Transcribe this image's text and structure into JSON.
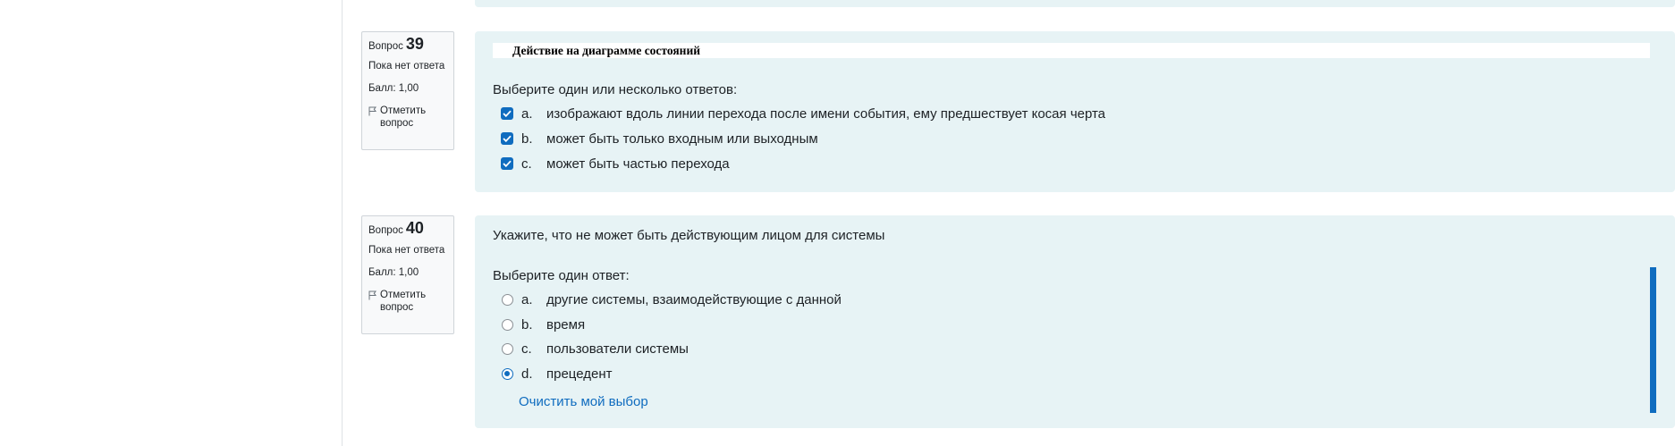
{
  "questions": [
    {
      "label": "Вопрос",
      "number": "39",
      "status": "Пока нет ответа",
      "grade": "Балл: 1,00",
      "flag_label": "Отметить вопрос",
      "text": "Действие на диаграмме состояний",
      "prompt": "Выберите один или несколько ответов:",
      "type": "checkbox",
      "options": [
        {
          "letter": "a.",
          "text": "изображают вдоль линии перехода после имени события, ему предшествует косая черта",
          "checked": true
        },
        {
          "letter": "b.",
          "text": "может быть только входным или выходным",
          "checked": true
        },
        {
          "letter": "c.",
          "text": "может быть частью перехода",
          "checked": true
        }
      ]
    },
    {
      "label": "Вопрос",
      "number": "40",
      "status": "Пока нет ответа",
      "grade": "Балл: 1,00",
      "flag_label": "Отметить вопрос",
      "text": "Укажите, что не может быть действующим лицом для системы",
      "prompt": "Выберите один ответ:",
      "type": "radio",
      "options": [
        {
          "letter": "a.",
          "text": "другие системы, взаимодействующие с данной",
          "checked": false
        },
        {
          "letter": "b.",
          "text": "время",
          "checked": false
        },
        {
          "letter": "c.",
          "text": "пользователи системы",
          "checked": false
        },
        {
          "letter": "d.",
          "text": "прецедент",
          "checked": true
        }
      ],
      "clear_label": "Очистить мой выбор"
    }
  ],
  "colors": {
    "accent": "#0f6cbf",
    "question_bg": "#e7f3f5",
    "info_bg": "#f8f9fa"
  }
}
